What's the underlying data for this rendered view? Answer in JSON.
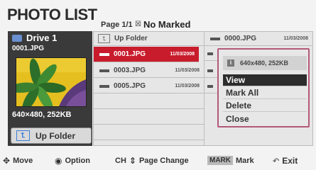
{
  "header": {
    "title": "PHOTO LIST",
    "page_info": "Page 1/1",
    "marked_label": "No Marked"
  },
  "preview": {
    "drive_label": "Drive 1",
    "file_name": "0001.JPG",
    "resolution": "640×480, 252KB",
    "up_folder_label": "Up Folder"
  },
  "files": {
    "up_folder": "Up Folder",
    "col1": [
      {
        "name": "0001.JPG",
        "date": "11/03/2008"
      },
      {
        "name": "0003.JPG",
        "date": "11/03/2008"
      },
      {
        "name": "0005.JPG",
        "date": "11/03/2008"
      }
    ],
    "col2": [
      {
        "name": "0000.JPG",
        "date": "11/03/2008"
      }
    ]
  },
  "popup": {
    "info": "640x480, 252KB",
    "items": [
      "View",
      "Mark All",
      "Delete",
      "Close"
    ]
  },
  "footer": {
    "move": "Move",
    "option": "Option",
    "ch": "CH",
    "page_change": "Page Change",
    "mark_badge": "MARK",
    "mark": "Mark",
    "exit": "Exit"
  }
}
